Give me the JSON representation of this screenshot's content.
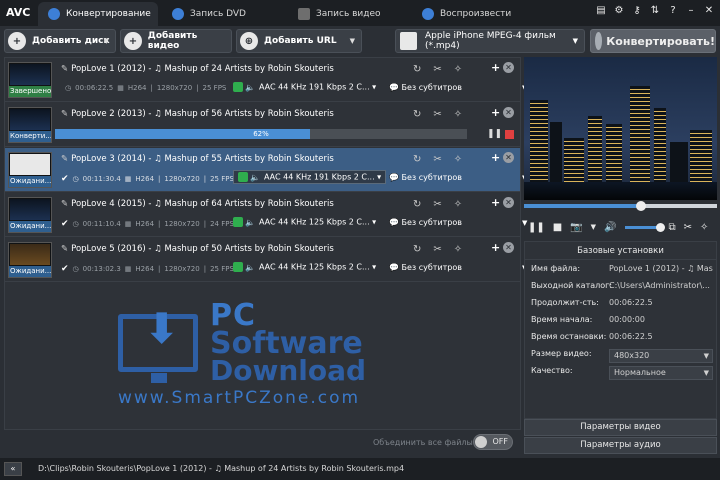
{
  "app": {
    "logo": "AVC"
  },
  "tabs": [
    {
      "label": "Конвертирование"
    },
    {
      "label": "Запись DVD"
    },
    {
      "label": "Запись видео"
    },
    {
      "label": "Воспроизвести"
    }
  ],
  "toolbar": {
    "add_disc": "Добавить диск",
    "add_video": "Добавить видео",
    "add_url": "Добавить URL",
    "profile": "Apple iPhone MPEG-4 фильм (*.mp4)",
    "convert": "Конвертировать!"
  },
  "files": [
    {
      "title": "PopLove 1 (2012) - ♫ Mashup of 24 Artists by Robin Skouteris",
      "duration": "00:06:22.5",
      "codec": "H264",
      "resolution": "1280x720",
      "fps": "25 FPS",
      "audio": "AAC 44 KHz 191 Kbps 2 C...",
      "subtitles": "Без субтитров",
      "status": "Завершено"
    },
    {
      "title": "PopLove 2 (2013) - ♫ Mashup of 56 Artists by Robin Skouteris",
      "status": "Конверти...",
      "progress": 62,
      "progress_label": "62%"
    },
    {
      "title": "PopLove 3 (2014) - ♫ Mashup of 55 Artists by Robin Skouteris",
      "duration": "00:11:30.4",
      "codec": "H264",
      "resolution": "1280x720",
      "fps": "25 FPS",
      "audio": "AAC 44 KHz 191 Kbps 2 C...",
      "subtitles": "Без субтитров",
      "status": "Ожидани..."
    },
    {
      "title": "PopLove 4 (2015) - ♫ Mashup of 64 Artists by Robin Skouteris",
      "duration": "00:11:10.4",
      "codec": "H264",
      "resolution": "1280x720",
      "fps": "24 FPS",
      "audio": "AAC 44 KHz 125 Kbps 2 C...",
      "subtitles": "Без субтитров",
      "status": "Ожидани..."
    },
    {
      "title": "PopLove 5 (2016) - ♫ Mashup of 50 Artists by Robin Skouteris",
      "duration": "00:13:02.3",
      "codec": "H264",
      "resolution": "1280x720",
      "fps": "25 FPS",
      "audio": "AAC 44 KHz 125 Kbps 2 C...",
      "subtitles": "Без субтитров",
      "status": "Ожидани..."
    }
  ],
  "merge_label": "Объединить все файлы",
  "toggle_label": "OFF",
  "settings": {
    "header": "Базовые установки",
    "rows": [
      {
        "key": "Имя файла:",
        "value": "PopLove 1 (2012) - ♫ Mash"
      },
      {
        "key": "Выходной каталог:",
        "value": "C:\\Users\\Administrator\\..."
      },
      {
        "key": "Продолжит-сть:",
        "value": "00:06:22.5"
      },
      {
        "key": "Время начала:",
        "value": "00:00:00"
      },
      {
        "key": "Время остановки:",
        "value": "00:06:22.5"
      },
      {
        "key": "Размер видео:",
        "value": "480x320"
      },
      {
        "key": "Качество:",
        "value": "Нормальное"
      }
    ],
    "video_params": "Параметры видео",
    "audio_params": "Параметры аудио"
  },
  "statusbar": {
    "collapse": "«",
    "path": "D:\\Clips\\Robin Skouteris\\PopLove 1 (2012) - ♫ Mashup of 24 Artists by Robin Skouteris.mp4"
  },
  "watermark": {
    "line1": "PC",
    "line2": "Software",
    "line3": "Download",
    "url": "www.SmartPCZone.com"
  },
  "colors": {
    "background": "#2b2f35",
    "accent": "#4a8fd4",
    "selected_row": "#3c5e85",
    "done_badge": "#2f7f45",
    "stop": "#e04040"
  }
}
